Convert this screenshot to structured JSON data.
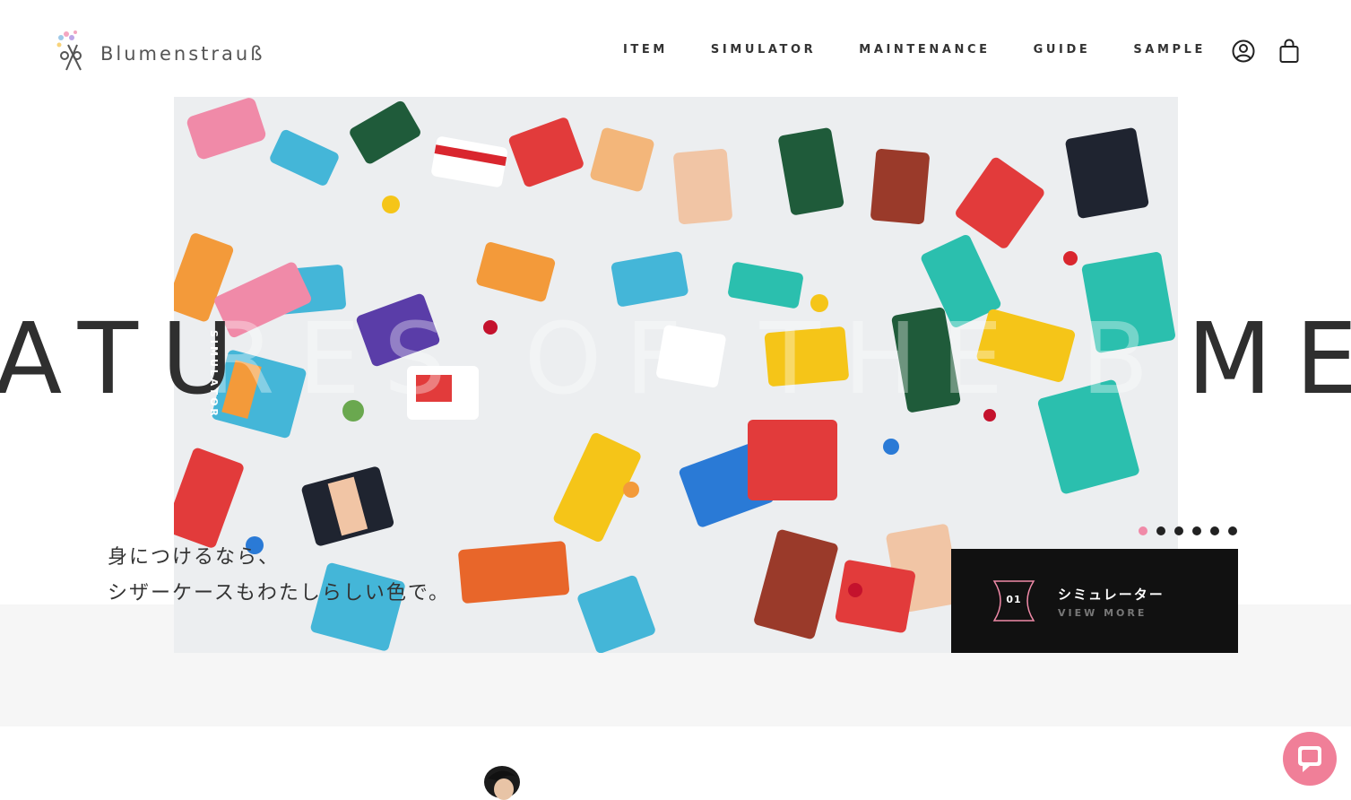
{
  "brand": {
    "name": "Blumenstrauß"
  },
  "nav": {
    "items": [
      {
        "label": "ITEM"
      },
      {
        "label": "SIMULATOR"
      },
      {
        "label": "MAINTENANCE"
      },
      {
        "label": "GUIDE"
      },
      {
        "label": "SAMPLE"
      }
    ]
  },
  "icons": {
    "account": "account-icon",
    "cart": "shopping-bag-icon",
    "chat": "chat-icon"
  },
  "hero": {
    "big_left": "ATU",
    "big_right": "ME",
    "ghost_text": "RES OF THE BLU",
    "vertical_label": "SIMULATOR",
    "catch_line1": "身につけるなら、",
    "catch_line2": "シザーケースもわたしらしい色で。",
    "slide_count": 6,
    "active_slide": 1
  },
  "card": {
    "number": "01",
    "title": "シミュレーター",
    "more": "VIEW MORE"
  },
  "colors": {
    "accent": "#f08aa8",
    "card_bg": "#111111",
    "band": "#f6f6f6"
  }
}
